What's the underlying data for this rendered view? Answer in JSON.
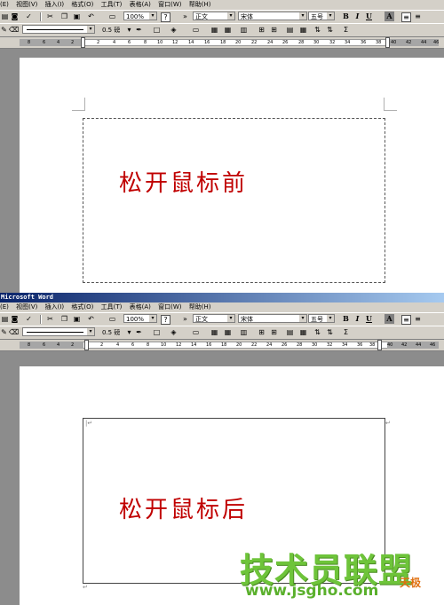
{
  "menubar": {
    "items": [
      "(E)",
      "视图(V)",
      "插入(I)",
      "格式(O)",
      "工具(T)",
      "表格(A)",
      "窗口(W)",
      "帮助(H)"
    ]
  },
  "window_title": "Microsoft Word",
  "toolbar": {
    "zoom": "100%",
    "help_glyph": "?",
    "style": "正文",
    "font": "宋体",
    "font_size": "五号",
    "bold": "B",
    "italic": "I",
    "underline": "U",
    "font_color": "A"
  },
  "drawing_toolbar": {
    "line_weight": "0.5 磅",
    "sigma": "Σ"
  },
  "ruler": {
    "ticks": [
      "8",
      "6",
      "4",
      "2",
      "2",
      "4",
      "6",
      "8",
      "10",
      "12",
      "14",
      "16",
      "18",
      "20",
      "22",
      "24",
      "26",
      "28",
      "30",
      "32",
      "34",
      "36",
      "38",
      "40",
      "42",
      "44",
      "46"
    ]
  },
  "panels": {
    "before": {
      "text": "松开鼠标前"
    },
    "after": {
      "text": "松开鼠标后"
    }
  },
  "watermark": {
    "title": "技术员联盟",
    "url": "www.jsgho.com",
    "badge": "天极"
  }
}
